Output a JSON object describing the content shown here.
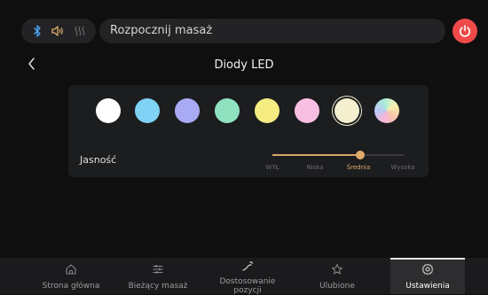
{
  "header": {
    "command_text": "Rozpocznij masaż",
    "icons": [
      "bluetooth-icon",
      "speaker-icon",
      "heat-icon",
      "power-icon"
    ]
  },
  "page": {
    "title": "Diody LED"
  },
  "led_panel": {
    "colors": [
      "#ffffff",
      "#7fd2f3",
      "#a8aaf3",
      "#8fe1c0",
      "#f5ec82",
      "#f8bfe2",
      "#f3efcf",
      "rainbow"
    ],
    "selected_index": 6,
    "brightness_label": "Jasność",
    "brightness_levels": [
      "WYŁ",
      "Niska",
      "Średnia",
      "Wysoka"
    ],
    "brightness_selected": "Średnia",
    "brightness_fraction": 0.667
  },
  "nav": {
    "items": [
      {
        "label": "Strona główna",
        "icon": "home-icon"
      },
      {
        "label": "Bieżący masaż",
        "icon": "sliders-icon"
      },
      {
        "label": "Dostosowanie pozycji",
        "icon": "position-icon"
      },
      {
        "label": "Ulubione",
        "icon": "star-icon"
      },
      {
        "label": "Ustawienia",
        "icon": "gear-icon"
      }
    ],
    "active_index": 4
  },
  "colors": {
    "accent": "#e0aa6d",
    "power": "#ef4a49",
    "background": "#0f0f10",
    "panel": "#1c1d1f"
  }
}
